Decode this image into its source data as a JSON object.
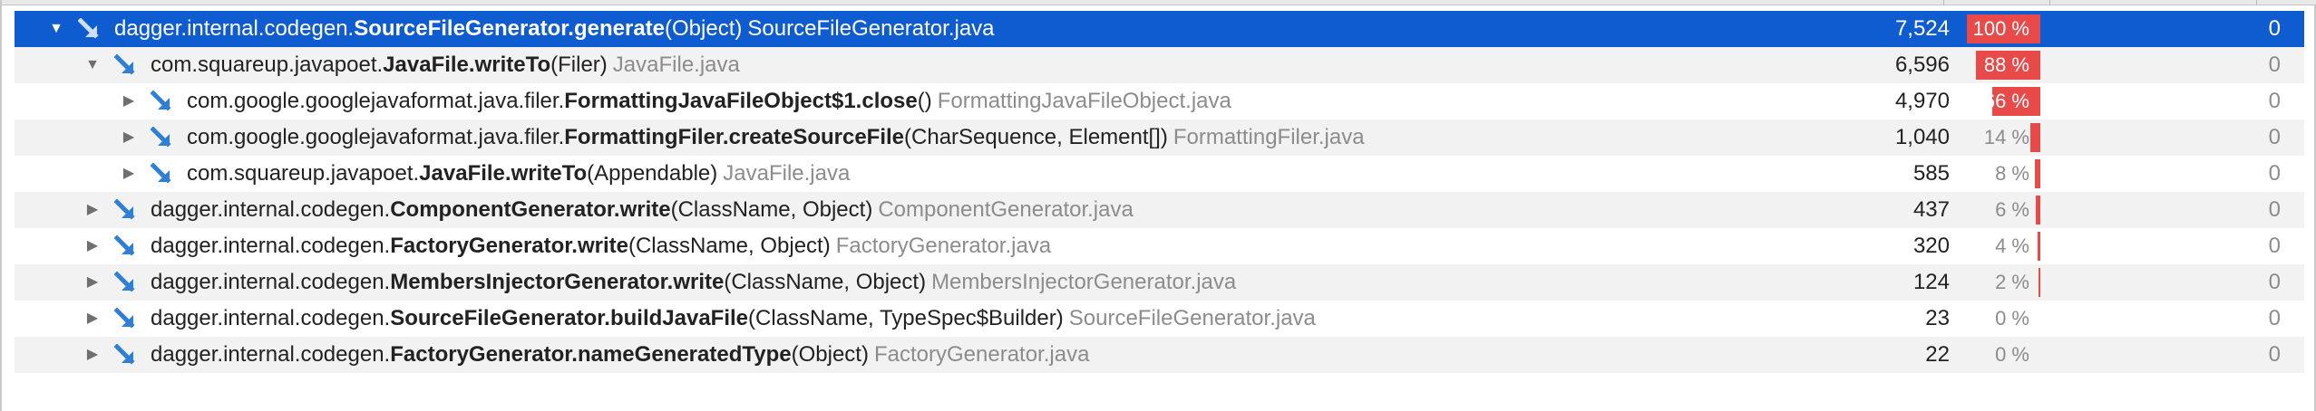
{
  "tree": {
    "rows": [
      {
        "depth": 0,
        "pkg": "dagger.internal.codegen.",
        "cls": "SourceFileGenerator.generate",
        "args": "(Object)",
        "file": "SourceFileGenerator.java",
        "time": "7,524",
        "pct": "100 %",
        "pct_value": 100,
        "own": "0",
        "expanded": true
      },
      {
        "depth": 1,
        "pkg": "com.squareup.javapoet.",
        "cls": "JavaFile.writeTo",
        "args": "(Filer)",
        "file": "JavaFile.java",
        "time": "6,596",
        "pct": "88 %",
        "pct_value": 88,
        "own": "0",
        "expanded": true
      },
      {
        "depth": 2,
        "pkg": "com.google.googlejavaformat.java.filer.",
        "cls": "FormattingJavaFileObject$1.close",
        "args": "()",
        "file": "FormattingJavaFileObject.java",
        "time": "4,970",
        "pct": "66 %",
        "pct_value": 66,
        "own": "0",
        "expanded": false
      },
      {
        "depth": 2,
        "pkg": "com.google.googlejavaformat.java.filer.",
        "cls": "FormattingFiler.createSourceFile",
        "args": "(CharSequence, Element[])",
        "file": "FormattingFiler.java",
        "time": "1,040",
        "pct": "14 %",
        "pct_value": 14,
        "own": "0",
        "expanded": false
      },
      {
        "depth": 2,
        "pkg": "com.squareup.javapoet.",
        "cls": "JavaFile.writeTo",
        "args": "(Appendable)",
        "file": "JavaFile.java",
        "time": "585",
        "pct": "8 %",
        "pct_value": 8,
        "own": "0",
        "expanded": false
      },
      {
        "depth": 1,
        "pkg": "dagger.internal.codegen.",
        "cls": "ComponentGenerator.write",
        "args": "(ClassName, Object)",
        "file": "ComponentGenerator.java",
        "time": "437",
        "pct": "6 %",
        "pct_value": 6,
        "own": "0",
        "expanded": false
      },
      {
        "depth": 1,
        "pkg": "dagger.internal.codegen.",
        "cls": "FactoryGenerator.write",
        "args": "(ClassName, Object)",
        "file": "FactoryGenerator.java",
        "time": "320",
        "pct": "4 %",
        "pct_value": 4,
        "own": "0",
        "expanded": false
      },
      {
        "depth": 1,
        "pkg": "dagger.internal.codegen.",
        "cls": "MembersInjectorGenerator.write",
        "args": "(ClassName, Object)",
        "file": "MembersInjectorGenerator.java",
        "time": "124",
        "pct": "2 %",
        "pct_value": 2,
        "own": "0",
        "expanded": false
      },
      {
        "depth": 1,
        "pkg": "dagger.internal.codegen.",
        "cls": "SourceFileGenerator.buildJavaFile",
        "args": "(ClassName, TypeSpec$Builder)",
        "file": "SourceFileGenerator.java",
        "time": "23",
        "pct": "0 %",
        "pct_value": 0,
        "own": "0",
        "expanded": false
      },
      {
        "depth": 1,
        "pkg": "dagger.internal.codegen.",
        "cls": "FactoryGenerator.nameGeneratedType",
        "args": "(Object)",
        "file": "FactoryGenerator.java",
        "time": "22",
        "pct": "0 %",
        "pct_value": 0,
        "own": "0",
        "expanded": false
      }
    ],
    "selected_index": 0
  },
  "colors": {
    "selection": "#0f5bd0",
    "percent_bar": "#e84a4a",
    "method_icon": "#2f7fd6"
  },
  "icons": {
    "expanded": "triangle-down-icon",
    "collapsed": "triangle-right-icon",
    "method": "method-call-arrow-icon"
  }
}
